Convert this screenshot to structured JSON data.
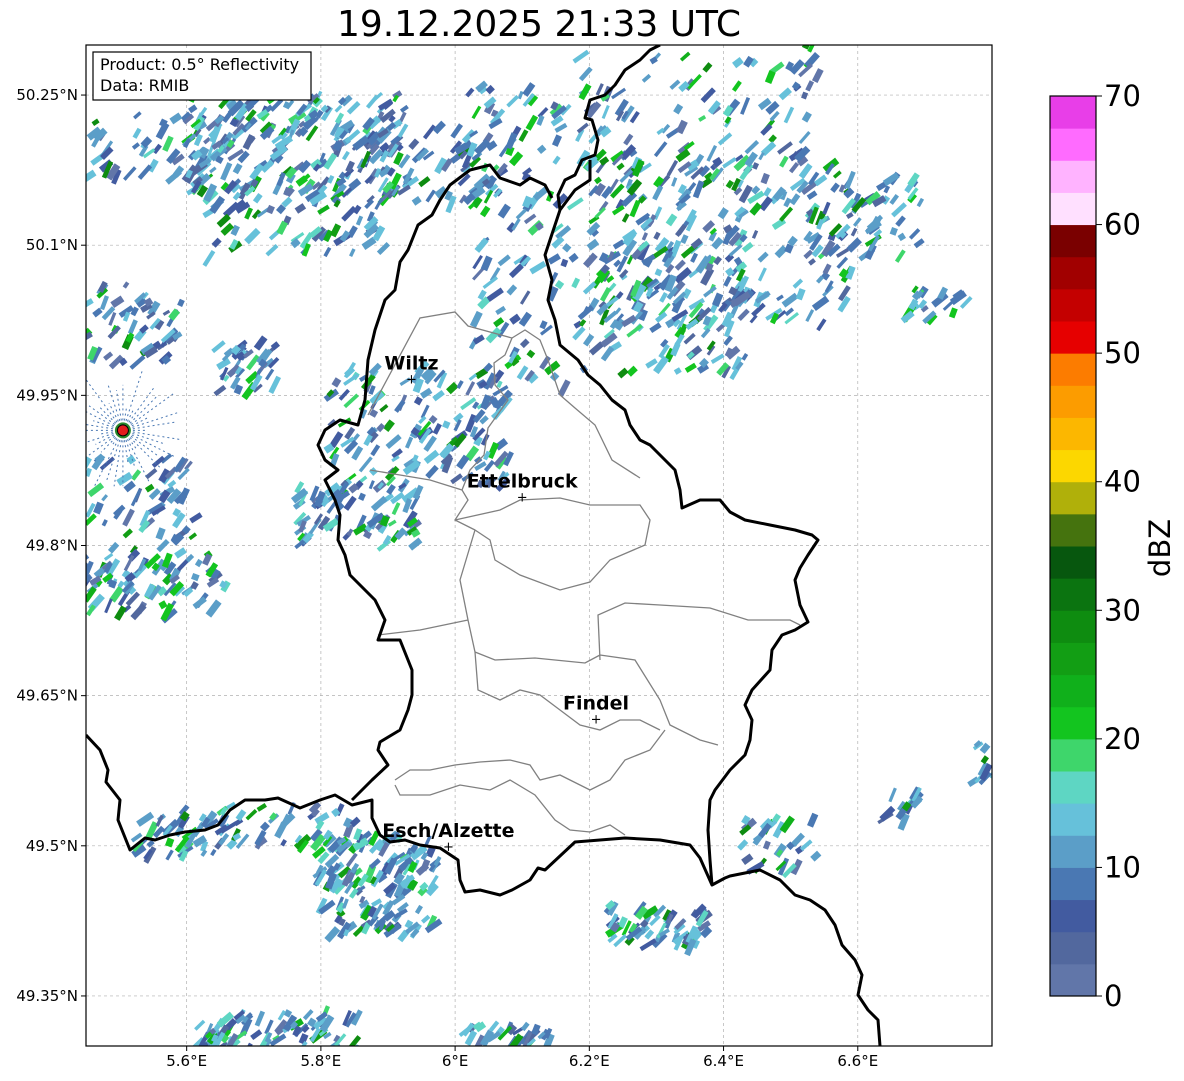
{
  "title": "19.12.2025 21:33 UTC",
  "info_box": {
    "product": "Product: 0.5° Reflectivity",
    "data_source": "Data: RMIB"
  },
  "map": {
    "lon_range": [
      5.45,
      6.8
    ],
    "lat_range": [
      49.3,
      50.3
    ],
    "lon_ticks": [
      {
        "value": 5.6,
        "label": "5.6°E"
      },
      {
        "value": 5.8,
        "label": "5.8°E"
      },
      {
        "value": 6.0,
        "label": "6°E"
      },
      {
        "value": 6.2,
        "label": "6.2°E"
      },
      {
        "value": 6.4,
        "label": "6.4°E"
      },
      {
        "value": 6.6,
        "label": "6.6°E"
      }
    ],
    "lat_ticks": [
      {
        "value": 50.25,
        "label": "50.25°N"
      },
      {
        "value": 50.1,
        "label": "50.1°N"
      },
      {
        "value": 49.95,
        "label": "49.95°N"
      },
      {
        "value": 49.8,
        "label": "49.8°N"
      },
      {
        "value": 49.65,
        "label": "49.65°N"
      },
      {
        "value": 49.5,
        "label": "49.5°N"
      },
      {
        "value": 49.35,
        "label": "49.35°N"
      }
    ],
    "grid": true,
    "radar_site": {
      "lon": 5.505,
      "lat": 49.915
    },
    "cities": [
      {
        "name": "Wiltz",
        "lon": 5.935,
        "lat": 49.967
      },
      {
        "name": "Ettelbruck",
        "lon": 6.1,
        "lat": 49.849
      },
      {
        "name": "Findel",
        "lon": 6.21,
        "lat": 49.627
      },
      {
        "name": "Esch/Alzette",
        "lon": 5.99,
        "lat": 49.5
      }
    ]
  },
  "colorbar": {
    "label": "dBZ",
    "min": 0,
    "max": 70,
    "tick_labels": [
      "0",
      "10",
      "20",
      "30",
      "40",
      "50",
      "60",
      "70"
    ],
    "colors": [
      "#6176a9",
      "#52689e",
      "#425ba0",
      "#4a78b3",
      "#5b9ec8",
      "#66c1da",
      "#5ed6c3",
      "#3ed66b",
      "#13c51f",
      "#10b01b",
      "#129e14",
      "#0e8c10",
      "#0b7410",
      "#07570e",
      "#45730e",
      "#b0b00a",
      "#fcd700",
      "#fcb700",
      "#fc9c00",
      "#fc7c00",
      "#e60000",
      "#c40000",
      "#a10000",
      "#7a0000",
      "#ffe0ff",
      "#ffb3ff",
      "#ff6bff",
      "#e83ee8"
    ]
  }
}
